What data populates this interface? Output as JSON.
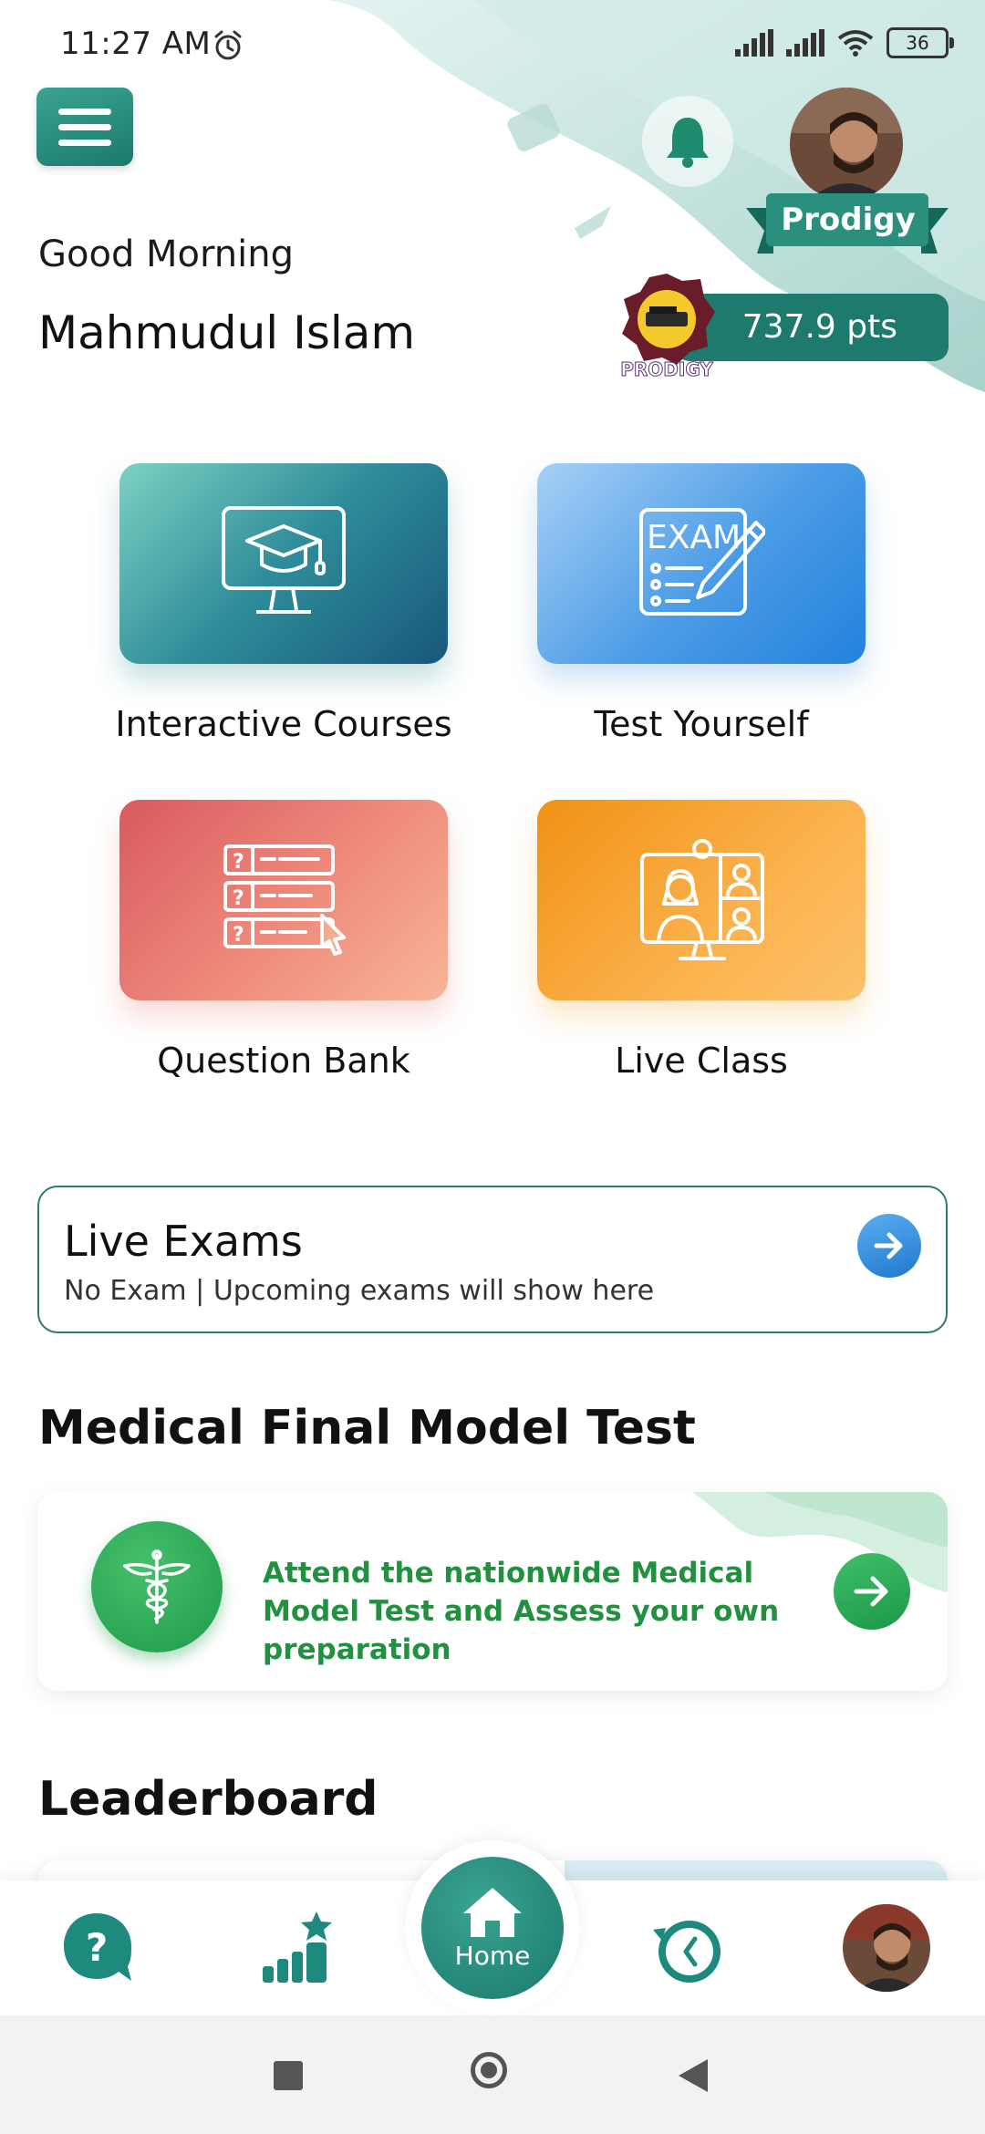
{
  "status_bar": {
    "time": "11:27 AM",
    "battery": "36"
  },
  "header": {
    "greeting": "Good Morning",
    "user_name": "Mahmudul Islam",
    "rank": "Prodigy",
    "badge_text": "PRODIGY",
    "points": "737.9 pts"
  },
  "tiles": [
    {
      "label": "Interactive Courses",
      "icon": "monitor-graduation-cap-icon"
    },
    {
      "label": "Test Yourself",
      "icon": "exam-sheet-pencil-icon",
      "icon_text": "EXAM"
    },
    {
      "label": "Question Bank",
      "icon": "question-list-cursor-icon"
    },
    {
      "label": "Live Class",
      "icon": "video-conference-icon"
    }
  ],
  "live_exams": {
    "title": "Live Exams",
    "subtitle": "No Exam | Upcoming exams will show here"
  },
  "medical": {
    "section_title": "Medical Final Model Test",
    "text": "Attend the nationwide Medical Model Test and Assess your own preparation"
  },
  "leaderboard": {
    "section_title": "Leaderboard"
  },
  "bottom_nav": {
    "home_label": "Home"
  },
  "colors": {
    "primary": "#1e7a6c",
    "accent_green": "#22913f",
    "accent_blue": "#2382dc"
  }
}
